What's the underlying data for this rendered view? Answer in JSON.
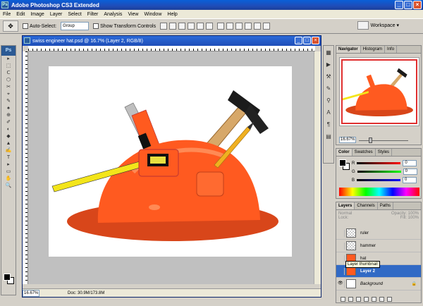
{
  "app": {
    "title": "Adobe Photoshop CS3 Extended",
    "window_buttons": [
      "_",
      "□",
      "×"
    ]
  },
  "menu": [
    "File",
    "Edit",
    "Image",
    "Layer",
    "Select",
    "Filter",
    "Analysis",
    "View",
    "Window",
    "Help"
  ],
  "options": {
    "auto_select_label": "Auto-Select:",
    "group_value": "Group",
    "transform_label": "Show Transform Controls",
    "workspace_label": "Workspace ▾"
  },
  "toolbox": {
    "logo": "Ps",
    "tools": [
      "▸",
      "⬚",
      "ᑕ",
      "⬡",
      "✂",
      "⌖",
      "✎",
      "♠",
      "⊕",
      "✐",
      "◐",
      "◆",
      "▲",
      "✍",
      "T",
      "▸",
      "▭",
      "✋",
      "🔍"
    ]
  },
  "document": {
    "title": "swiss engineer hat.psd @ 16.7% (Layer 2, RGB/8)",
    "zoom": "16.67%",
    "doc_info": "Doc: 30.9M/173.8M"
  },
  "navigator": {
    "tabs": [
      "Navigator",
      "Histogram",
      "Info"
    ],
    "zoom": "16.67%"
  },
  "color": {
    "tabs": [
      "Color",
      "Swatches",
      "Styles"
    ],
    "channels": [
      {
        "label": "R",
        "value": "0",
        "gradient": "#f00"
      },
      {
        "label": "G",
        "value": "0",
        "gradient": "#0f0"
      },
      {
        "label": "B",
        "value": "0",
        "gradient": "#00f"
      }
    ]
  },
  "layers": {
    "tabs": [
      "Layers",
      "Channels",
      "Paths"
    ],
    "blend_mode": "Normal",
    "opacity_label": "Opacity:",
    "opacity_value": "100%",
    "lock_label": "Lock:",
    "fill_label": "Fill:",
    "fill_value": "100%",
    "rows": [
      {
        "name": "ruler",
        "selected": false
      },
      {
        "name": "hammer",
        "selected": false
      },
      {
        "name": "hat",
        "selected": false
      },
      {
        "name": "Layer 2",
        "selected": true
      },
      {
        "name": "Background",
        "selected": false
      }
    ],
    "tooltip": "Layer thumbnail"
  }
}
